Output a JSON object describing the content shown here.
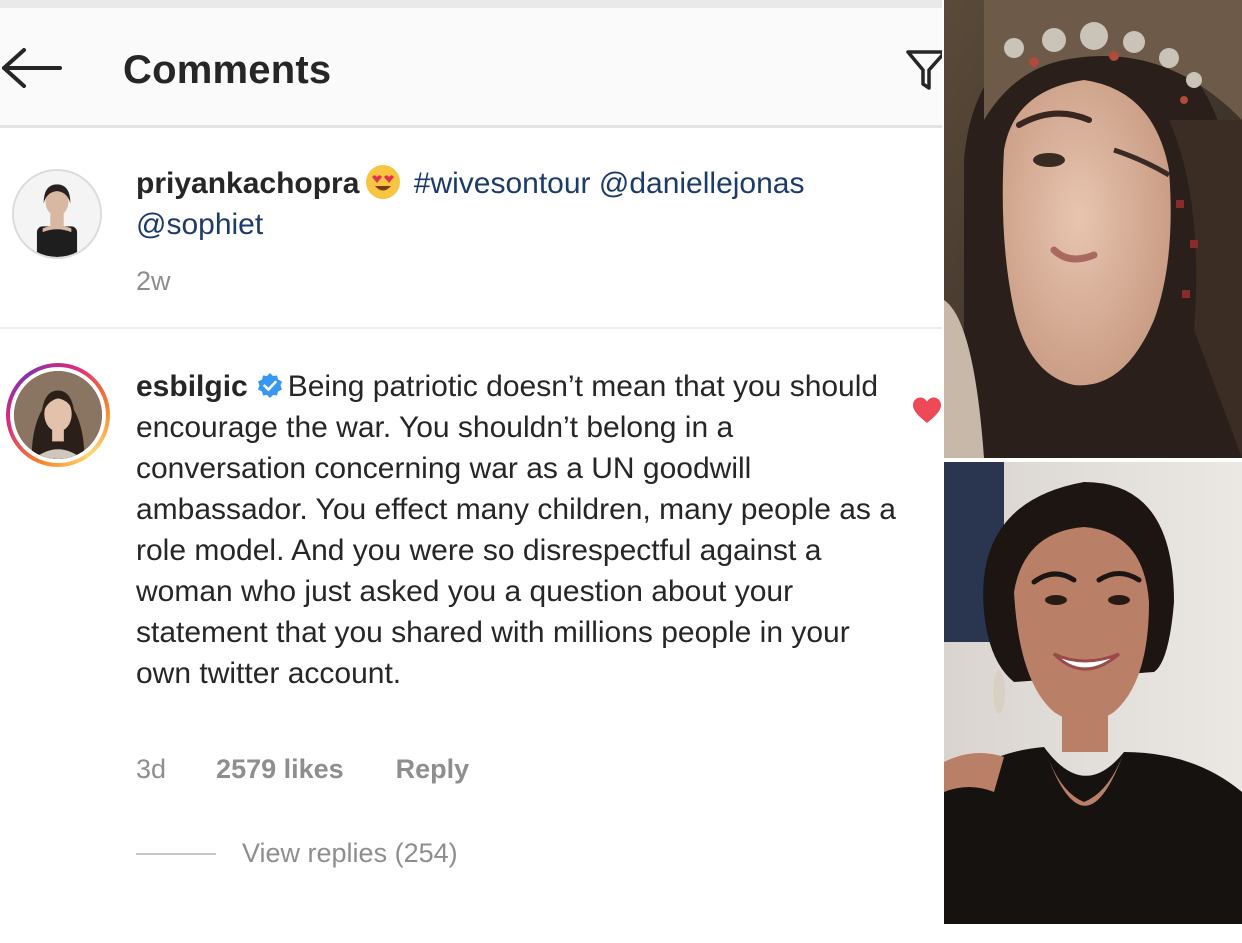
{
  "header": {
    "title": "Comments",
    "back_icon": "arrow-left-icon",
    "filter_icon": "filter-icon"
  },
  "comments": [
    {
      "username": "priyankachopra",
      "emoji": "heart-eyes-emoji",
      "hashtag": "#wivesontour",
      "mention1": "@daniellejonas",
      "mention2": "@sophiet",
      "time": "2w"
    },
    {
      "username": "esbilgic",
      "verified": true,
      "text": "Being patriotic doesn’t mean that you should encourage the war. You shouldn’t belong in a conversation concerning war as a UN goodwill ambassador. You effect many children, many people as a role model. And you were so disrespectful against a woman who just asked you a question about your statement that you shared with millions people in your own twitter account.",
      "time": "3d",
      "likes": "2579 likes",
      "reply": "Reply",
      "liked": true,
      "view_replies": "View replies (254)"
    }
  ],
  "colors": {
    "link": "#1d3b69",
    "verified": "#3897f0",
    "heart": "#ed4956",
    "meta": "#8e8e8e"
  },
  "photos": [
    {
      "name": "woman-in-headdress-photo"
    },
    {
      "name": "smiling-woman-photo"
    }
  ]
}
